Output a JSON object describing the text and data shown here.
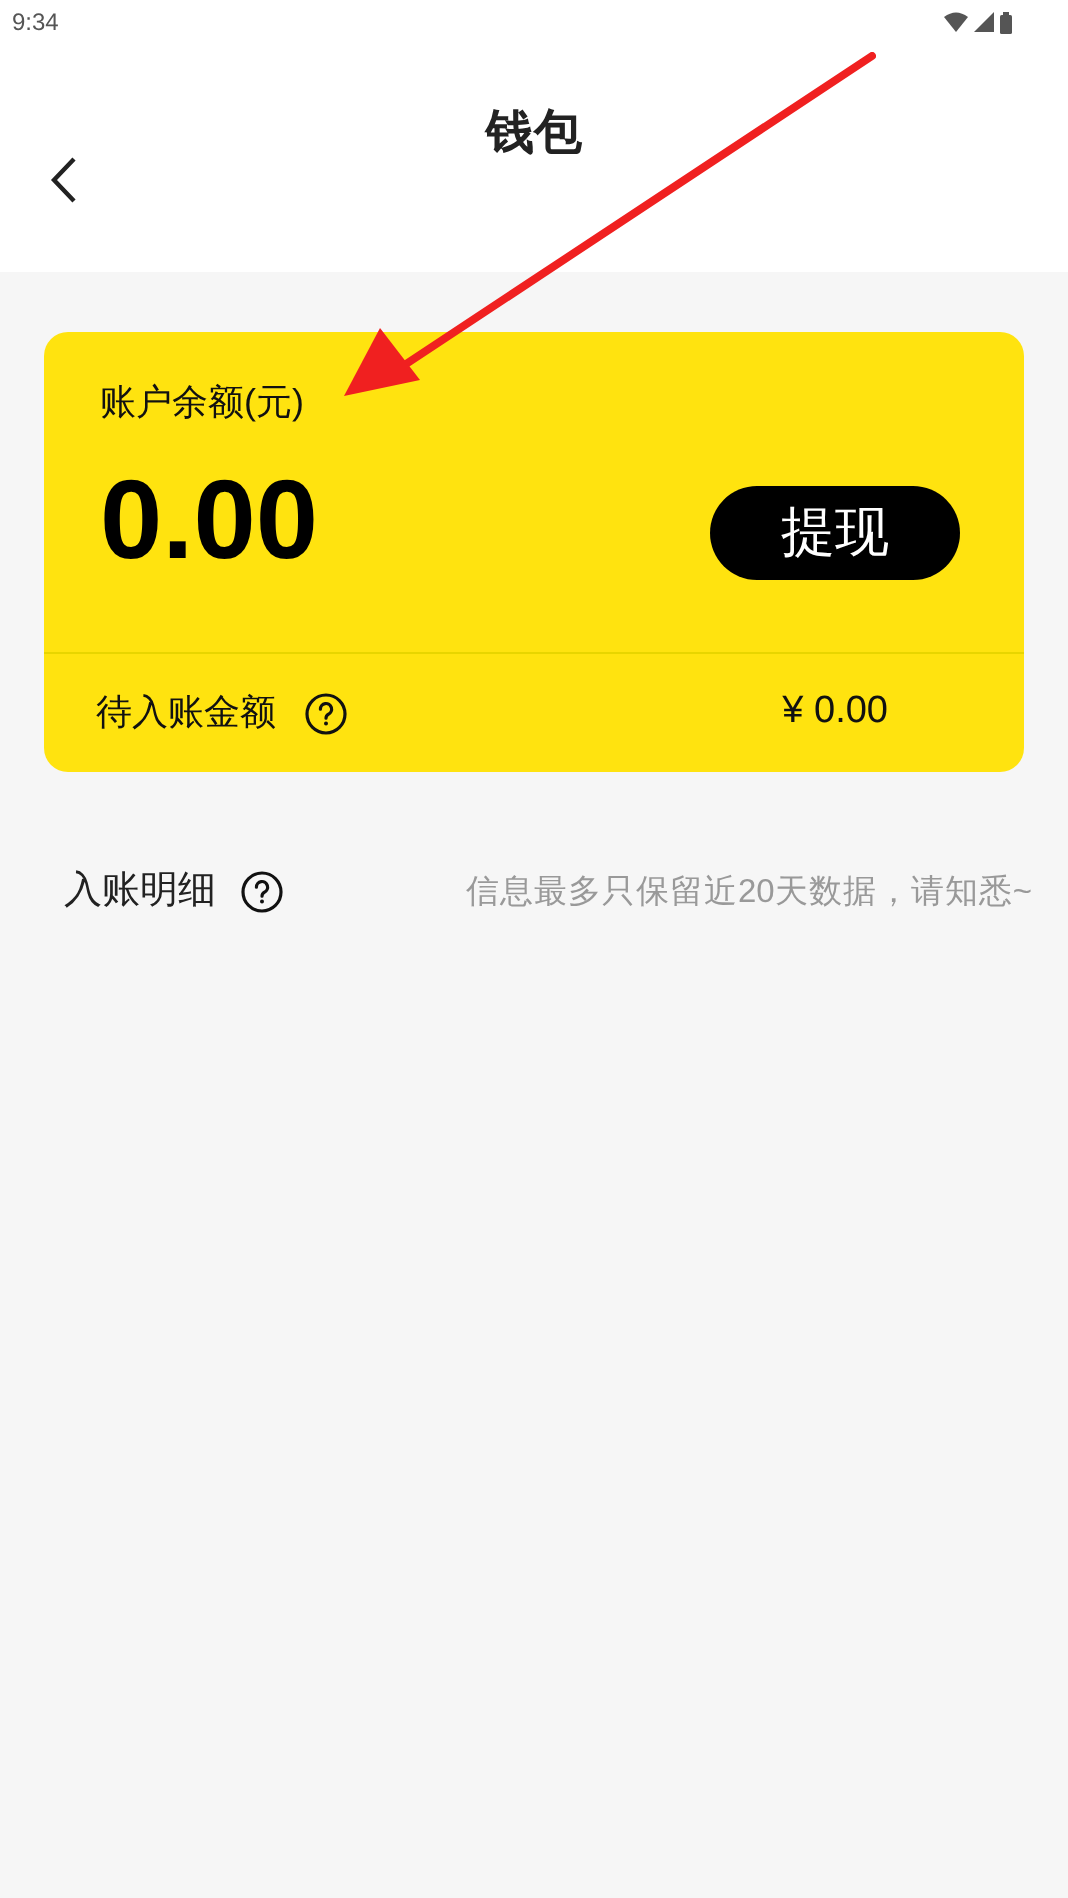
{
  "status_bar": {
    "time": "9:34"
  },
  "header": {
    "title": "钱包"
  },
  "balance_card": {
    "label": "账户余额(元)",
    "amount": "0.00",
    "withdraw_button": "提现",
    "pending_label": "待入账金额",
    "pending_amount": "¥ 0.00"
  },
  "details": {
    "title": "入账明细",
    "note": "信息最多只保留近20天数据，请知悉~"
  }
}
